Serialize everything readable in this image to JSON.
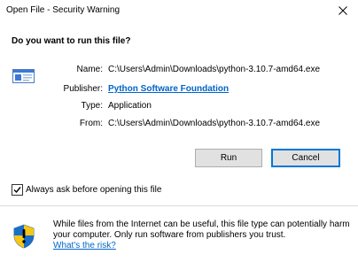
{
  "window": {
    "title": "Open File - Security Warning",
    "close_glyph": "✕"
  },
  "prompt": {
    "question": "Do you want to run this file?"
  },
  "file": {
    "icon": "executable-file-icon",
    "name_label": "Name:",
    "name_value": "C:\\Users\\Admin\\Downloads\\python-3.10.7-amd64.exe",
    "publisher_label": "Publisher:",
    "publisher_value": "Python Software Foundation",
    "type_label": "Type:",
    "type_value": "Application",
    "from_label": "From:",
    "from_value": "C:\\Users\\Admin\\Downloads\\python-3.10.7-amd64.exe"
  },
  "buttons": {
    "run_label": "Run",
    "cancel_label": "Cancel"
  },
  "options": {
    "always_ask_label": "Always ask before opening this file",
    "always_ask_checked": true
  },
  "warning": {
    "icon": "security-shield-icon",
    "text": "While files from the Internet can be useful, this file type can potentially harm your computer. Only run software from publishers you trust.",
    "link_text": "What's the risk?"
  },
  "colors": {
    "link": "#0064c8",
    "focus_border": "#0078d7",
    "button_face": "#e1e1e1",
    "shield_blue": "#1a6fc9",
    "shield_yellow": "#f5c518"
  }
}
